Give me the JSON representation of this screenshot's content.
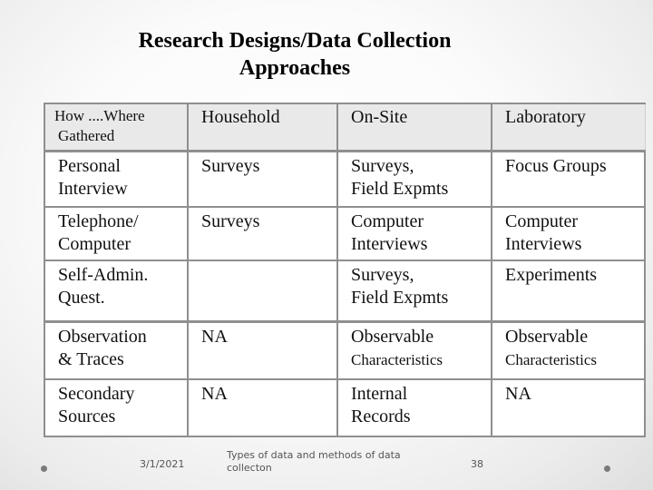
{
  "slide": {
    "title_lines": [
      "Research Designs/Data Collection",
      "Approaches"
    ]
  },
  "table": {
    "header": {
      "corner_lines": [
        "How ....Where",
        "Gathered"
      ],
      "columns": [
        "Household",
        "On-Site",
        "Laboratory"
      ]
    },
    "rows": [
      {
        "label_lines": [
          "Personal",
          "Interview"
        ],
        "household": [
          "Surveys"
        ],
        "onsite": [
          "Surveys,",
          "Field Expmts"
        ],
        "laboratory": [
          "Focus Groups"
        ]
      },
      {
        "label_lines": [
          "Telephone/",
          "Computer"
        ],
        "household": [
          "Surveys"
        ],
        "onsite": [
          "Computer",
          "Interviews"
        ],
        "laboratory": [
          "Computer",
          "Interviews"
        ]
      },
      {
        "label_lines": [
          "Self-Admin.",
          "Quest."
        ],
        "household": [],
        "onsite": [
          "Surveys,",
          "Field Expmts"
        ],
        "laboratory": [
          "Experiments"
        ]
      },
      {
        "label_lines": [
          "Observation",
          "& Traces"
        ],
        "household": [
          "NA"
        ],
        "onsite": [
          "Observable",
          "Characteristics"
        ],
        "laboratory": [
          "Observable",
          "Characteristics"
        ]
      },
      {
        "label_lines": [
          "Secondary",
          "Sources"
        ],
        "household": [
          "NA"
        ],
        "onsite": [
          "Internal",
          "Records"
        ],
        "laboratory": [
          "NA"
        ]
      }
    ]
  },
  "footer": {
    "date": "3/1/2021",
    "description": "Types of data and methods of data collecton",
    "page_number": "38"
  }
}
